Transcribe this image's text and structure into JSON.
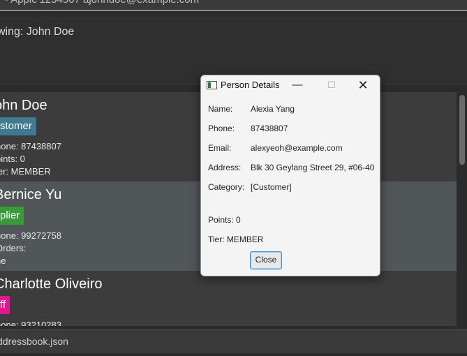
{
  "top_text": "'- Apple'1234567 ajohndoe@example.com",
  "result": {
    "text": "wing: John Doe"
  },
  "cards": [
    {
      "name": "ohn Doe",
      "tag": "stomer",
      "tag_type": "customer",
      "lines": [
        "hone: 87438807",
        "oints: 0",
        "ier: MEMBER"
      ]
    },
    {
      "name": "Bernice Yu",
      "tag": "plier",
      "tag_type": "supplier",
      "lines": [
        "hone: 99272758",
        "Orders:",
        "ne"
      ]
    },
    {
      "name": "Charlotte Oliveiro",
      "tag": "ff",
      "tag_type": "staff",
      "lines": [
        "hone: 93210283"
      ]
    }
  ],
  "status": {
    "text": "ddressbook.json"
  },
  "dialog": {
    "title": "Person Details",
    "minimize": "—",
    "maximize": "☐",
    "close_glyph": "✕",
    "fields": [
      {
        "label": "Name:",
        "value": "Alexia Yang"
      },
      {
        "label": "Phone:",
        "value": "87438807"
      },
      {
        "label": "Email:",
        "value": "alexyeoh@example.com"
      },
      {
        "label": "Address:",
        "value": "Blk 30 Geylang Street 29, #06-40"
      },
      {
        "label": "Category:",
        "value": "[Customer]"
      }
    ],
    "points": "Points: 0",
    "tier": "Tier: MEMBER",
    "close_label": "Close"
  },
  "colors": {
    "customer": "#3e7b91",
    "supplier": "#3a9a3a",
    "staff": "#e0188d",
    "accent": "#3d8fd6"
  }
}
